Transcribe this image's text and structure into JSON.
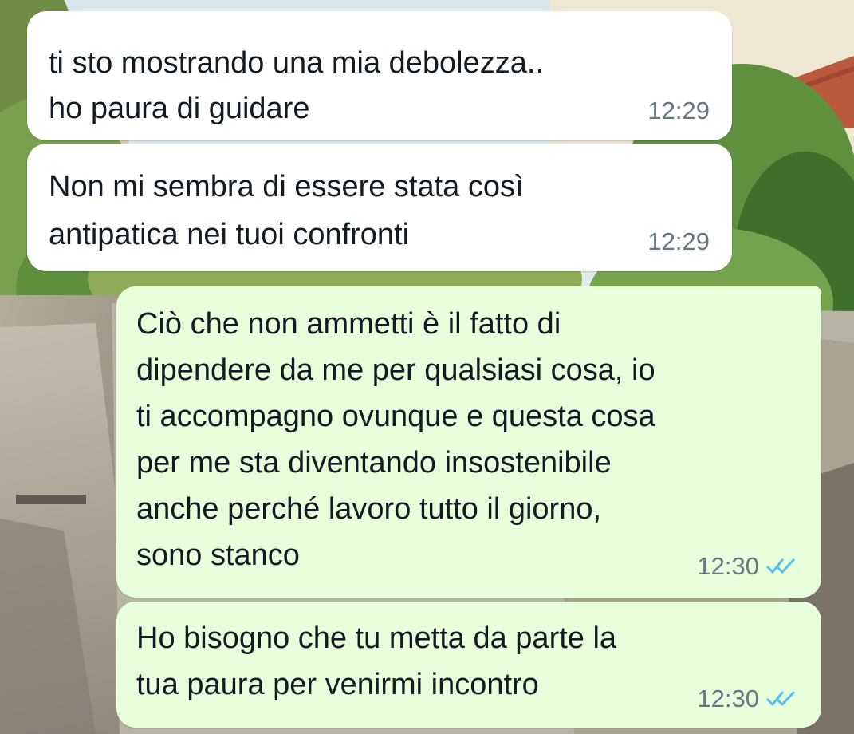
{
  "chat": {
    "messages": [
      {
        "direction": "incoming",
        "lines": [
          "ti sto mostrando una mia debolezza..",
          "ho paura di guidare"
        ],
        "time": "12:29"
      },
      {
        "direction": "incoming",
        "lines": [
          "Non mi sembra di essere stata così",
          "antipatica nei tuoi confronti"
        ],
        "time": "12:29"
      },
      {
        "direction": "outgoing",
        "lines": [
          "Ciò che non ammetti è il fatto di",
          "dipendere da me per qualsiasi cosa, io",
          "ti accompagno ovunque e questa cosa",
          "per me sta diventando insostenibile",
          "anche perché lavoro tutto il giorno,",
          "sono stanco"
        ],
        "time": "12:30",
        "status": "read",
        "status_icon": "double-check-icon"
      },
      {
        "direction": "outgoing",
        "lines": [
          "Ho bisogno che tu metta da parte la",
          "tua paura per venirmi incontro"
        ],
        "time": "12:30",
        "status": "read",
        "status_icon": "double-check-icon"
      }
    ],
    "colors": {
      "incoming_bubble": "#ffffff",
      "outgoing_bubble": "#e7ffdb",
      "timestamp": "#667781",
      "read_check": "#53bdeb"
    }
  }
}
